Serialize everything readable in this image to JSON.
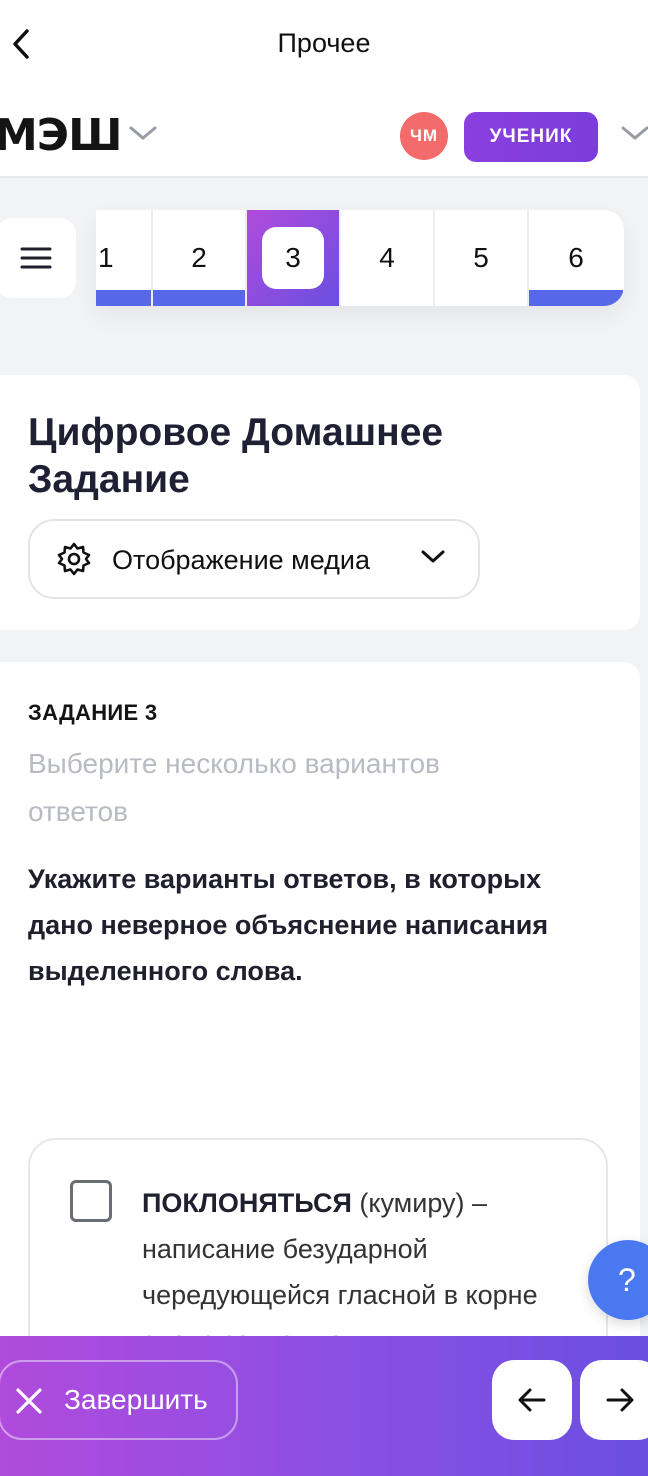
{
  "topbar": {
    "title": "Прочее"
  },
  "header": {
    "logo": "МЭШ",
    "avatar_initials": "ЧМ",
    "role": "УЧЕНИК",
    "avatar_color": "#f36b6b",
    "accent": "#7b3ddb"
  },
  "tabs": [
    {
      "label": "1",
      "answered": true
    },
    {
      "label": "2",
      "answered": true
    },
    {
      "label": "3",
      "active": true
    },
    {
      "label": "4",
      "answered": false
    },
    {
      "label": "5",
      "answered": false
    },
    {
      "label": "6",
      "answered": true
    }
  ],
  "homework": {
    "title": "Цифровое Домашнее Задание",
    "media_select_label": "Отображение медиа"
  },
  "task": {
    "number_label": "ЗАДАНИЕ 3",
    "hint": "Выберите несколько вариантов ответов",
    "question": "Укажите варианты ответов, в которых дано неверное объяснение написания выделенного слова.",
    "options": [
      {
        "word": "ПОКЛОНЯТЬСЯ",
        "text": " (кумиру) – написание безударной чередующейся гласной в корне слова зависит от"
      }
    ]
  },
  "help": {
    "label": "?"
  },
  "bottom": {
    "finish_label": "Завершить"
  }
}
